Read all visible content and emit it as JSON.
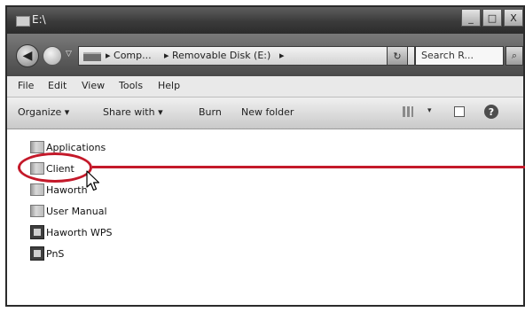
{
  "window": {
    "title": "E:\\",
    "buttons": {
      "minimize": "_",
      "maximize": "□",
      "close": "X"
    }
  },
  "address": {
    "back_icon": "back-arrow-icon",
    "history_arrow": "▽",
    "crumbs": [
      "▸ Comp...",
      "▸ Removable Disk (E:)",
      "▸"
    ],
    "dropdown": "▾",
    "refresh_icon": "↻",
    "search_placeholder": "Search R...",
    "search_icon": "magnifier-icon"
  },
  "menu": {
    "items": [
      "File",
      "Edit",
      "View",
      "Tools",
      "Help"
    ]
  },
  "toolbar": {
    "organize": "Organize ▾",
    "share_with": "Share with ▾",
    "burn": "Burn",
    "new_folder": "New folder",
    "view_arrow": "▾",
    "help": "?"
  },
  "files": [
    {
      "name": "Applications",
      "type": "folder"
    },
    {
      "name": "Client",
      "type": "folder"
    },
    {
      "name": "Haworth",
      "type": "folder"
    },
    {
      "name": "User Manual",
      "type": "folder"
    },
    {
      "name": "Haworth WPS",
      "type": "app"
    },
    {
      "name": "PnS",
      "type": "app"
    }
  ],
  "annotation": {
    "color": "#c4192a"
  }
}
